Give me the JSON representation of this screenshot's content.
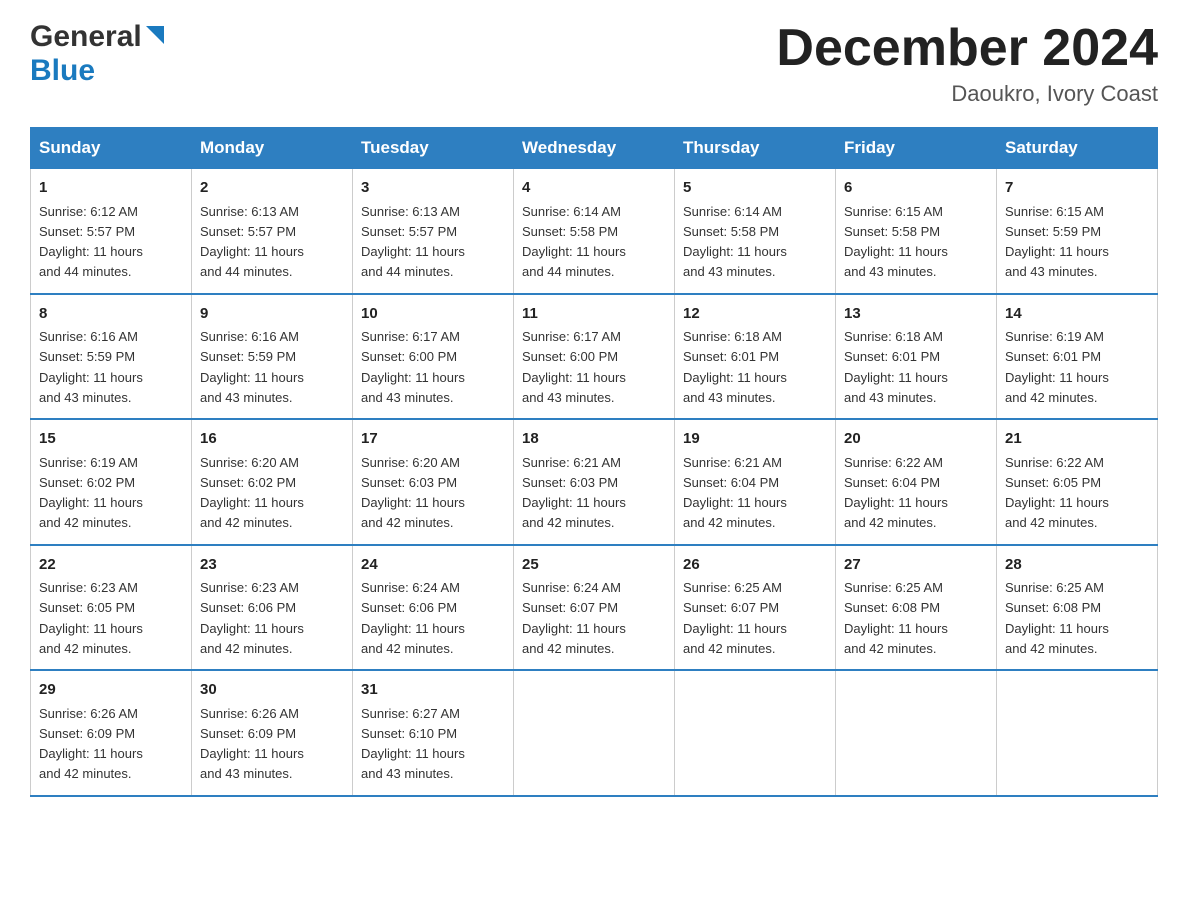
{
  "header": {
    "logo_general": "General",
    "logo_blue": "Blue",
    "month_title": "December 2024",
    "location": "Daoukro, Ivory Coast"
  },
  "weekdays": [
    "Sunday",
    "Monday",
    "Tuesday",
    "Wednesday",
    "Thursday",
    "Friday",
    "Saturday"
  ],
  "weeks": [
    [
      {
        "day": "1",
        "sunrise": "6:12 AM",
        "sunset": "5:57 PM",
        "daylight": "11 hours and 44 minutes."
      },
      {
        "day": "2",
        "sunrise": "6:13 AM",
        "sunset": "5:57 PM",
        "daylight": "11 hours and 44 minutes."
      },
      {
        "day": "3",
        "sunrise": "6:13 AM",
        "sunset": "5:57 PM",
        "daylight": "11 hours and 44 minutes."
      },
      {
        "day": "4",
        "sunrise": "6:14 AM",
        "sunset": "5:58 PM",
        "daylight": "11 hours and 44 minutes."
      },
      {
        "day": "5",
        "sunrise": "6:14 AM",
        "sunset": "5:58 PM",
        "daylight": "11 hours and 43 minutes."
      },
      {
        "day": "6",
        "sunrise": "6:15 AM",
        "sunset": "5:58 PM",
        "daylight": "11 hours and 43 minutes."
      },
      {
        "day": "7",
        "sunrise": "6:15 AM",
        "sunset": "5:59 PM",
        "daylight": "11 hours and 43 minutes."
      }
    ],
    [
      {
        "day": "8",
        "sunrise": "6:16 AM",
        "sunset": "5:59 PM",
        "daylight": "11 hours and 43 minutes."
      },
      {
        "day": "9",
        "sunrise": "6:16 AM",
        "sunset": "5:59 PM",
        "daylight": "11 hours and 43 minutes."
      },
      {
        "day": "10",
        "sunrise": "6:17 AM",
        "sunset": "6:00 PM",
        "daylight": "11 hours and 43 minutes."
      },
      {
        "day": "11",
        "sunrise": "6:17 AM",
        "sunset": "6:00 PM",
        "daylight": "11 hours and 43 minutes."
      },
      {
        "day": "12",
        "sunrise": "6:18 AM",
        "sunset": "6:01 PM",
        "daylight": "11 hours and 43 minutes."
      },
      {
        "day": "13",
        "sunrise": "6:18 AM",
        "sunset": "6:01 PM",
        "daylight": "11 hours and 43 minutes."
      },
      {
        "day": "14",
        "sunrise": "6:19 AM",
        "sunset": "6:01 PM",
        "daylight": "11 hours and 42 minutes."
      }
    ],
    [
      {
        "day": "15",
        "sunrise": "6:19 AM",
        "sunset": "6:02 PM",
        "daylight": "11 hours and 42 minutes."
      },
      {
        "day": "16",
        "sunrise": "6:20 AM",
        "sunset": "6:02 PM",
        "daylight": "11 hours and 42 minutes."
      },
      {
        "day": "17",
        "sunrise": "6:20 AM",
        "sunset": "6:03 PM",
        "daylight": "11 hours and 42 minutes."
      },
      {
        "day": "18",
        "sunrise": "6:21 AM",
        "sunset": "6:03 PM",
        "daylight": "11 hours and 42 minutes."
      },
      {
        "day": "19",
        "sunrise": "6:21 AM",
        "sunset": "6:04 PM",
        "daylight": "11 hours and 42 minutes."
      },
      {
        "day": "20",
        "sunrise": "6:22 AM",
        "sunset": "6:04 PM",
        "daylight": "11 hours and 42 minutes."
      },
      {
        "day": "21",
        "sunrise": "6:22 AM",
        "sunset": "6:05 PM",
        "daylight": "11 hours and 42 minutes."
      }
    ],
    [
      {
        "day": "22",
        "sunrise": "6:23 AM",
        "sunset": "6:05 PM",
        "daylight": "11 hours and 42 minutes."
      },
      {
        "day": "23",
        "sunrise": "6:23 AM",
        "sunset": "6:06 PM",
        "daylight": "11 hours and 42 minutes."
      },
      {
        "day": "24",
        "sunrise": "6:24 AM",
        "sunset": "6:06 PM",
        "daylight": "11 hours and 42 minutes."
      },
      {
        "day": "25",
        "sunrise": "6:24 AM",
        "sunset": "6:07 PM",
        "daylight": "11 hours and 42 minutes."
      },
      {
        "day": "26",
        "sunrise": "6:25 AM",
        "sunset": "6:07 PM",
        "daylight": "11 hours and 42 minutes."
      },
      {
        "day": "27",
        "sunrise": "6:25 AM",
        "sunset": "6:08 PM",
        "daylight": "11 hours and 42 minutes."
      },
      {
        "day": "28",
        "sunrise": "6:25 AM",
        "sunset": "6:08 PM",
        "daylight": "11 hours and 42 minutes."
      }
    ],
    [
      {
        "day": "29",
        "sunrise": "6:26 AM",
        "sunset": "6:09 PM",
        "daylight": "11 hours and 42 minutes."
      },
      {
        "day": "30",
        "sunrise": "6:26 AM",
        "sunset": "6:09 PM",
        "daylight": "11 hours and 43 minutes."
      },
      {
        "day": "31",
        "sunrise": "6:27 AM",
        "sunset": "6:10 PM",
        "daylight": "11 hours and 43 minutes."
      },
      null,
      null,
      null,
      null
    ]
  ],
  "labels": {
    "sunrise": "Sunrise:",
    "sunset": "Sunset:",
    "daylight": "Daylight:"
  }
}
